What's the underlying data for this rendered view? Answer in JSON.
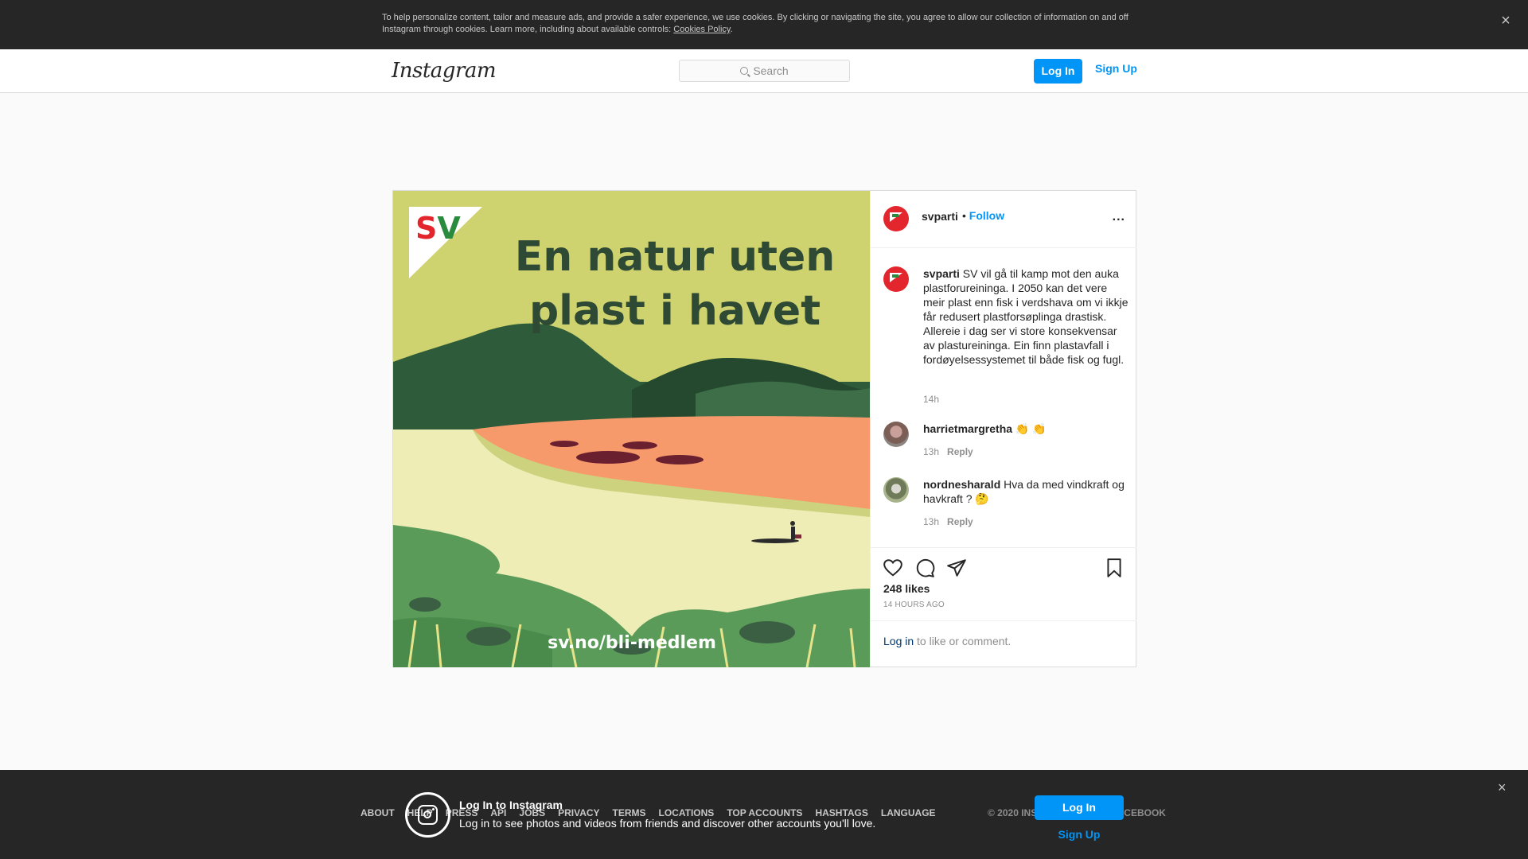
{
  "cookie_banner": {
    "text": "To help personalize content, tailor and measure ads, and provide a safer experience, we use cookies. By clicking or navigating the site, you agree to allow our collection of information on and off Instagram through cookies. Learn more, including about available controls: ",
    "link": "Cookies Policy",
    "period": ".",
    "close": "×"
  },
  "header": {
    "logo": "Instagram",
    "search_placeholder": "Search",
    "login": "Log In",
    "signup": "Sign Up"
  },
  "post": {
    "image": {
      "headline_1": "En natur uten",
      "headline_2": "plast i havet",
      "brand": "SV",
      "url": "sv.no/bli-medlem"
    },
    "author": "svparti",
    "follow_sep": "• ",
    "follow": "Follow",
    "more": "...",
    "caption": {
      "username": "svparti",
      "text": " SV vil gå til kamp mot den auka plastforureininga. I 2050 kan det vere meir plast enn fisk i verdshava om vi ikkje får redusert plastforsøplinga drastisk. Allereie i dag ser vi store konsekvensar av plastureininga. Ein finn plastavfall i fordøyelsessystemet til både fisk og fugl.",
      "time": "14h"
    },
    "comments": [
      {
        "username": "harrietmargretha",
        "text": " 👏 👏",
        "time": "13h",
        "reply": "Reply"
      },
      {
        "username": "nordnesharald",
        "text": " Hva da med vindkraft og havkraft ? 🤔",
        "time": "13h",
        "reply": "Reply"
      }
    ],
    "icons": {
      "like": "heart-icon",
      "comment": "comment-icon",
      "share": "share-icon",
      "save": "bookmark-icon"
    },
    "likes": "248 likes",
    "time_ago": "14 HOURS AGO",
    "login_prompt": {
      "link": "Log in",
      "text": " to like or comment."
    }
  },
  "footer": {
    "links": [
      "ABOUT",
      "HELP",
      "PRESS",
      "API",
      "JOBS",
      "PRIVACY",
      "TERMS",
      "LOCATIONS",
      "TOP ACCOUNTS",
      "HASHTAGS",
      "LANGUAGE"
    ],
    "copyright": "© 2020 INSTAGRAM FROM FACEBOOK"
  },
  "login_banner": {
    "title": "Log In to Instagram",
    "subtitle": "Log in to see photos and videos from friends and discover other accounts you'll love.",
    "login": "Log In",
    "signup": "Sign Up",
    "close": "×"
  },
  "colors": {
    "accent": "#0095f6",
    "dark_banner": "#262626",
    "border": "#dbdbdb",
    "image_sky": "#cfd36f",
    "image_water": "#f79a6b",
    "image_beach": "#eeedb6",
    "image_hill_dark": "#2e5c3a",
    "image_grass": "#5b9b5a"
  }
}
